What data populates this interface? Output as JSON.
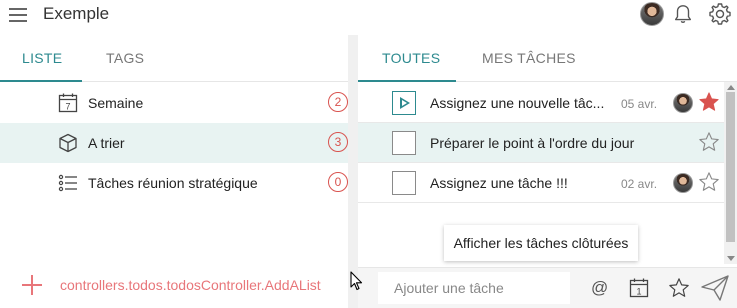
{
  "app": {
    "title": "Exemple"
  },
  "colors": {
    "accent": "#2d8a8f",
    "danger": "#d9534f",
    "link_red": "#e8767a",
    "selected_bg": "#e8f3f2"
  },
  "left": {
    "tabs": [
      {
        "label": "LISTE",
        "active": true
      },
      {
        "label": "TAGS",
        "active": false
      }
    ],
    "lists": [
      {
        "icon": "calendar-icon",
        "icon_text": "7",
        "label": "Semaine",
        "count": "2",
        "selected": false
      },
      {
        "icon": "cube-icon",
        "label": "A trier",
        "count": "3",
        "selected": true
      },
      {
        "icon": "list-icon",
        "label": "Tâches réunion stratégique",
        "count": "0",
        "selected": false
      }
    ],
    "add_list_label": "controllers.todos.todosController.AddAList"
  },
  "right": {
    "tabs": [
      {
        "label": "TOUTES",
        "active": true
      },
      {
        "label": "MES TÂCHES",
        "active": false
      }
    ],
    "tasks": [
      {
        "title": "Assignez une nouvelle tâc...",
        "date": "05 avr.",
        "has_avatar": true,
        "starred": true,
        "in_progress": true,
        "selected": false
      },
      {
        "title": "Préparer le point à l'ordre du jour",
        "date": "",
        "has_avatar": false,
        "starred": false,
        "in_progress": false,
        "selected": true
      },
      {
        "title": "Assignez une tâche !!!",
        "date": "02 avr.",
        "has_avatar": true,
        "starred": false,
        "in_progress": false,
        "selected": false
      }
    ],
    "show_closed_label": "Afficher les tâches clôturées",
    "add_task_placeholder": "Ajouter une tâche",
    "at_symbol": "@",
    "calendar_day": "1"
  }
}
